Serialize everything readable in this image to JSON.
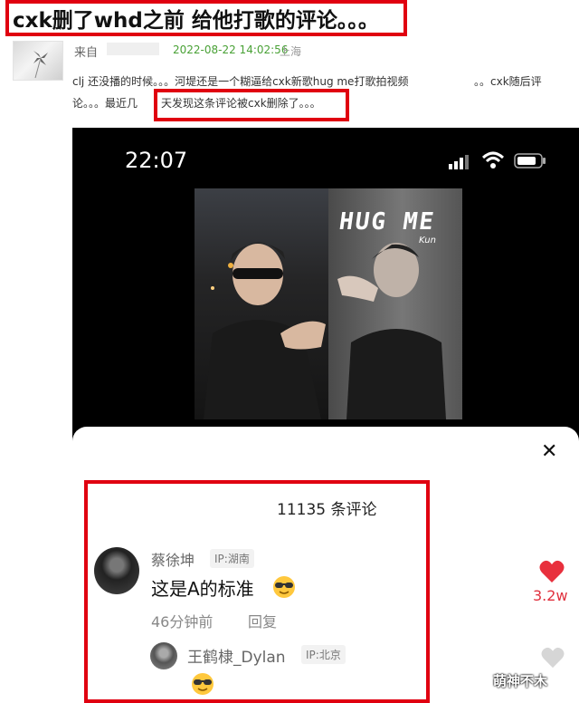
{
  "headline": "cxk删了whd之前 给他打歌的评论。。。",
  "post": {
    "from_label": "来自",
    "time": "2022-08-22 14:02:56",
    "location": "上海",
    "body_line1": "clj 还没播的时候。。。河堤还是一个糊逼给cxk新歌hug me打歌拍视频",
    "body_line1_tail": "。。cxk随后评",
    "body_line2_start": "论。。。最近几",
    "body_line2_highlight": "天发现这条评论被cxk删除了。。。"
  },
  "phone": {
    "clock": "22:07",
    "video_title": "HUG ME",
    "video_signature": "Kun",
    "comment_count": "11135 条评论",
    "comments": [
      {
        "user": "蔡徐坤",
        "ip": "IP:湖南",
        "text": "这是A的标准",
        "time": "46分钟前",
        "reply": "回复",
        "likes": "3.2w"
      },
      {
        "user": "王鹤棣_Dylan",
        "ip": "IP:北京"
      }
    ]
  },
  "watermark": "萌神不木",
  "colors": {
    "highlight_red": "#e00010",
    "like_red": "#e8303d",
    "time_green": "#49a136"
  }
}
